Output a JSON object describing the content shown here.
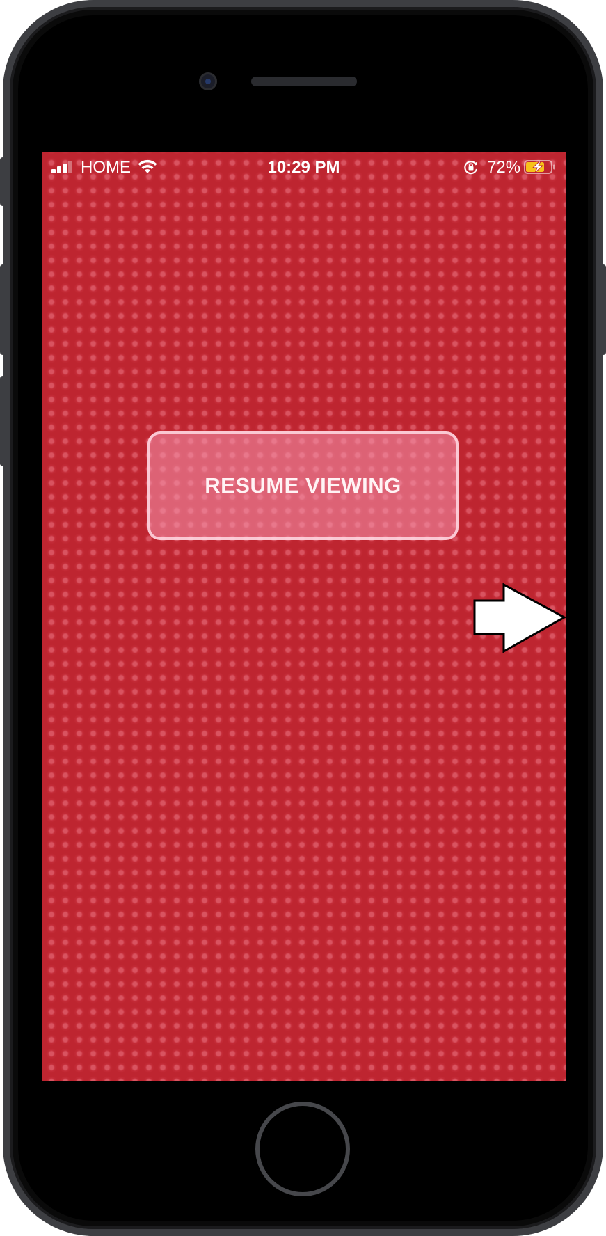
{
  "status_bar": {
    "carrier": "HOME",
    "time": "10:29 PM",
    "battery_percent": "72%",
    "signal_bars_active": 3,
    "signal_bars_total": 4,
    "battery_level": 0.72,
    "charging": true,
    "icons": {
      "signal": "cellular-signal-icon",
      "wifi": "wifi-icon",
      "rotation_lock": "orientation-lock-icon",
      "battery": "battery-charging-icon"
    }
  },
  "main": {
    "resume_label": "RESUME VIEWING",
    "next_icon": "right-arrow-icon"
  },
  "colors": {
    "screen_background": "#be2530",
    "button_fill": "#f696af",
    "battery_charging": "#f7c21a",
    "phone_frame": "#3d3e42"
  }
}
